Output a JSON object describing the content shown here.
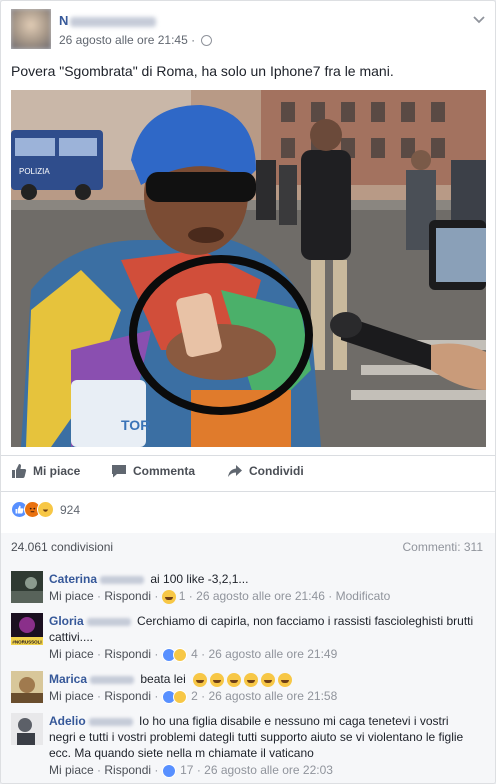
{
  "post": {
    "author_initial": "N",
    "timestamp": "26 agosto alle ore 21:45 ·",
    "text": "Povera \"Sgombrata\" di Roma, ha solo un Iphone7 fra le mani.",
    "photo": {
      "sign_text": "POLIZIA",
      "mic_text": "TOR"
    }
  },
  "actions": {
    "like": "Mi piace",
    "comment": "Commenta",
    "share": "Condividi"
  },
  "reactions": {
    "count": "924",
    "types": [
      "like-icon",
      "angry-icon",
      "haha-icon"
    ]
  },
  "stats": {
    "shares": "24.061 condivisioni",
    "comments": "Commenti: 311"
  },
  "comments": [
    {
      "name": "Caterina",
      "text": "ai 100 like -3,2,1...",
      "like": "Mi piace",
      "reply": "Rispondi",
      "reaction_count": "1",
      "time": "26 agosto alle ore 21:46",
      "edited": "Modificato"
    },
    {
      "name": "Gloria",
      "text": "Cerchiamo di capirla, non facciamo i rassisti fascioleghisti brutti cattivi....",
      "avatar_text": "#NORUSSOLI",
      "like": "Mi piace",
      "reply": "Rispondi",
      "reaction_count": "4",
      "time": "26 agosto alle ore 21:49"
    },
    {
      "name": "Marica",
      "text": "beata lei",
      "like": "Mi piace",
      "reply": "Rispondi",
      "reaction_count": "2",
      "time": "26 agosto alle ore 21:58"
    },
    {
      "name": "Adelio",
      "text": "Io ho una figlia disabile e nessuno mi caga tenetevi i vostri negri e tutti i vostri problemi dategli tutti supporto aiuto se vi violentano le figlie ecc. Ma quando siete nella m chiamate il vaticano",
      "like": "Mi piace",
      "reply": "Rispondi",
      "reaction_count": "17",
      "time": "26 agosto alle ore 22:03"
    }
  ],
  "separator": "·"
}
